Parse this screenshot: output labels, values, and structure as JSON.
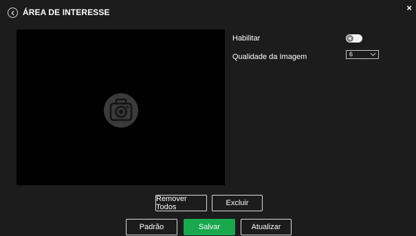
{
  "header": {
    "title": "ÁREA DE INTERESSE",
    "close_label": "×"
  },
  "preview": {
    "placeholder_icon": "camera-icon"
  },
  "settings": {
    "enable_label": "Habilitar",
    "enable_on": false,
    "quality_label": "Qualidade da Imagem",
    "quality_value": "6"
  },
  "actions": {
    "remove_all_label": "Remover Todos",
    "delete_label": "Excluir"
  },
  "footer": {
    "default_label": "Padrão",
    "save_label": "Salvar",
    "refresh_label": "Atualizar"
  },
  "colors": {
    "background": "#1c1c1c",
    "preview": "#000000",
    "primary": "#1aa84f"
  }
}
